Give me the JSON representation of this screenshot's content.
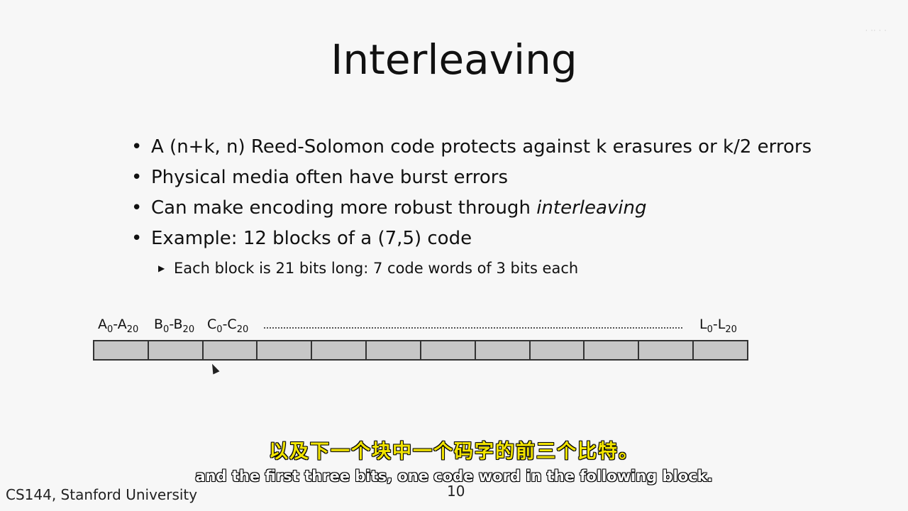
{
  "slide": {
    "title": "Interleaving",
    "bullets": [
      {
        "text": "A (n+k, n) Reed-Solomon code protects against k erasures or k/2 errors"
      },
      {
        "text": "Physical media often have burst errors"
      },
      {
        "text_before": "Can make encoding more robust through ",
        "text_italic": "interleaving"
      },
      {
        "text": "Example: 12 blocks of a (7,5) code"
      }
    ],
    "sub_bullet": "Each block is 21 bits long: 7 code words of 3 bits each",
    "diagram": {
      "labels": [
        {
          "a": "A",
          "a_sub": "0",
          "b": "-A",
          "b_sub": "20"
        },
        {
          "a": "B",
          "a_sub": "0",
          "b": "-B",
          "b_sub": "20"
        },
        {
          "a": "C",
          "a_sub": "0",
          "b": "-C",
          "b_sub": "20"
        },
        {
          "a": "L",
          "a_sub": "0",
          "b": "-L",
          "b_sub": "20"
        }
      ],
      "block_count": 12
    },
    "footer": "CS144, Stanford University",
    "page_number": "10"
  },
  "subtitles": {
    "chinese": "以及下一个块中一个码字的前三个比特。",
    "english": "and the first three bits, one code word in the following block."
  }
}
